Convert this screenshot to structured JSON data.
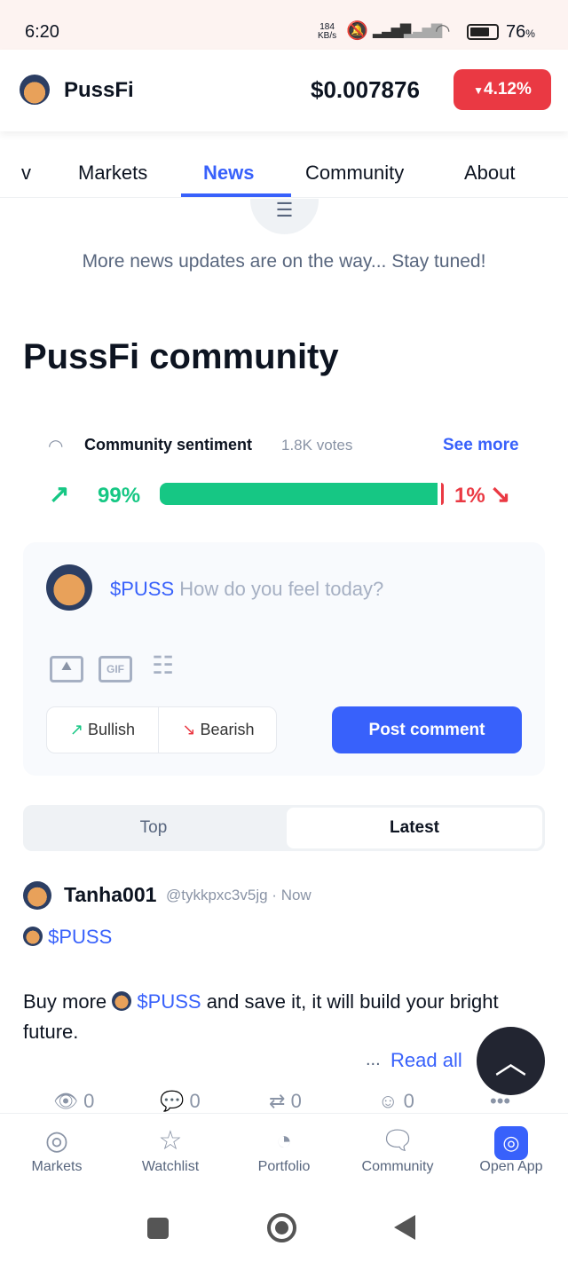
{
  "status_bar": {
    "time": "6:20",
    "net_speed": "184",
    "net_unit": "KB/s",
    "battery": "76",
    "battery_unit": "%"
  },
  "header": {
    "coin_name": "PussFi",
    "price": "$0.007876",
    "change": "4.12%",
    "change_color": "#ea3943"
  },
  "tabs": [
    {
      "label": "v"
    },
    {
      "label": "Markets"
    },
    {
      "label": "News",
      "active": true
    },
    {
      "label": "Community"
    },
    {
      "label": "About"
    }
  ],
  "news": {
    "empty_message": "More news updates are on the way... Stay tuned!"
  },
  "community": {
    "title": "PussFi community",
    "sentiment": {
      "label": "Community sentiment",
      "votes": "1.8K votes",
      "see_more": "See more",
      "bullish_pct": "99%",
      "bearish_pct": "1%",
      "bullish_value": 99,
      "bullish_color": "#16c784",
      "bearish_color": "#ea3943"
    },
    "composer": {
      "ticker": "$PUSS",
      "placeholder": "How do you feel today?",
      "gif_label": "GIF",
      "bullish": "Bullish",
      "bearish": "Bearish",
      "post": "Post comment"
    },
    "feed_tabs": [
      {
        "label": "Top"
      },
      {
        "label": "Latest",
        "active": true
      }
    ],
    "post": {
      "author": "Tanha001",
      "handle": "@tykkpxc3v5jg",
      "time": "Now",
      "tag": "$PUSS",
      "body_pre": "Buy more",
      "body_tag": "$PUSS",
      "body_post": "and save it, it will build your bright future.",
      "dots": "...",
      "read_all": "Read all",
      "views": "0",
      "comments": "0",
      "reposts": "0",
      "reactions": "0"
    }
  },
  "bottom_nav": [
    {
      "label": "Markets"
    },
    {
      "label": "Watchlist"
    },
    {
      "label": "Portfolio"
    },
    {
      "label": "Community"
    },
    {
      "label": "Open App"
    }
  ]
}
